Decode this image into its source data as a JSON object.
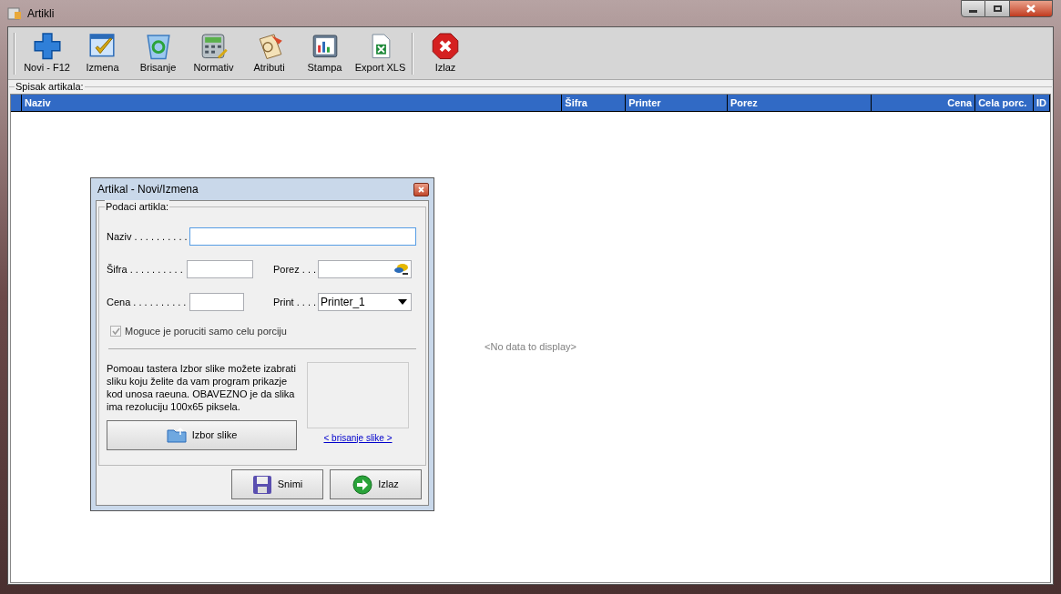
{
  "window": {
    "title": "Artikli"
  },
  "toolbar": [
    {
      "label": "Novi - F12"
    },
    {
      "label": "Izmena"
    },
    {
      "label": "Brisanje"
    },
    {
      "label": "Normativ"
    },
    {
      "label": "Atributi"
    },
    {
      "label": "Stampa"
    },
    {
      "label": "Export XLS"
    },
    {
      "label": "Izlaz"
    }
  ],
  "list": {
    "label": "Spisak artikala:",
    "columns": [
      {
        "label": "Naziv"
      },
      {
        "label": "Šifra"
      },
      {
        "label": "Printer"
      },
      {
        "label": "Porez"
      },
      {
        "label": "Cena"
      },
      {
        "label": "Cela porc."
      },
      {
        "label": "ID"
      }
    ],
    "empty_text": "<No data to display>"
  },
  "dialog": {
    "title": "Artikal - Novi/Izmena",
    "group_label": "Podaci artikla:",
    "fields": [
      {
        "kind": "text",
        "label": "Naziv . . . . . . . . . .",
        "focused": true
      },
      {
        "kind": "text",
        "label": "Šifra . . . . . . . . . .",
        "focused": false
      },
      {
        "kind": "lookup",
        "label": "Porez . . .",
        "focused": false
      },
      {
        "kind": "text",
        "label": "Cena . . . . . . . . . .",
        "focused": false
      },
      {
        "kind": "dropdown",
        "label": "Print . . . .",
        "value": "Printer_1",
        "focused": false
      }
    ],
    "checkbox": {
      "label": "Moguce je poruciti samo celu porciju",
      "checked": true,
      "disabled": true
    },
    "info": "Pomoau tastera Izbor slike možete izabrati sliku koju želite da vam program prikazje kod unosa raeuna. OBAVEZNO je da slika ima rezoluciju 100x65 piksela.",
    "image_button": "Izbor slike",
    "link": "< brisanje slike >",
    "buttons": [
      {
        "label": "Snimi"
      },
      {
        "label": "Izlaz"
      }
    ]
  }
}
